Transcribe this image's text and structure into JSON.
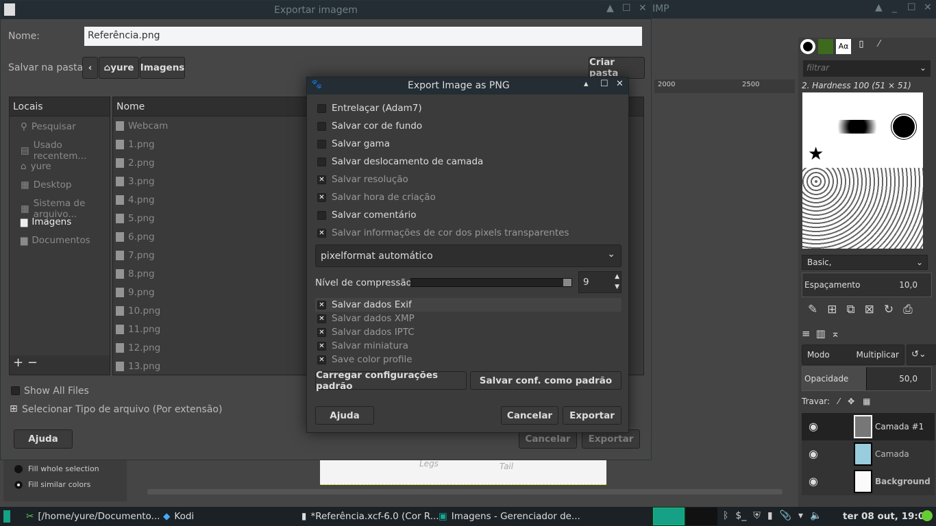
{
  "gimp": {
    "title": "IMP",
    "ruler": [
      "2000",
      "2500"
    ],
    "dock": {
      "filter_placeholder": "filtrar",
      "brush_name": "2. Hardness 100 (51 × 51)",
      "preset": "Basic,",
      "spacing_label": "Espaçamento",
      "spacing_value": "10,0",
      "mode_label": "Modo",
      "mode_value": "Multiplicar",
      "opacity_label": "Opacidade",
      "opacity_value": "50,0",
      "opacity_fraction": 0.5,
      "lock_label": "Travar:",
      "layers": [
        {
          "name": "Camada #1",
          "selected": true
        },
        {
          "name": "Camada",
          "selected": false
        },
        {
          "name": "Background",
          "selected": false
        }
      ]
    },
    "toolbox": {
      "fill_whole": "Fill whole selection",
      "fill_similar": "Fill similar colors"
    },
    "canvas_text": [
      "Legs",
      "Tail"
    ]
  },
  "export": {
    "title": "Exportar imagem",
    "name_label": "Nome:",
    "name_value": "Referência.png",
    "folder_label": "Salvar na pasta:",
    "path": [
      "yure",
      "Imagens"
    ],
    "create_folder": "Criar pasta",
    "places_header": "Locais",
    "places": [
      "Pesquisar",
      "Usado recentem...",
      "yure",
      "Desktop",
      "Sistema de arquivo...",
      "Imagens",
      "Documentos"
    ],
    "files_header": "Nome",
    "files": [
      "Webcam",
      "1.png",
      "2.png",
      "3.png",
      "4.png",
      "5.png",
      "6.png",
      "7.png",
      "8.png",
      "9.png",
      "10.png",
      "11.png",
      "12.png",
      "13.png"
    ],
    "show_all": "Show All Files",
    "select_type": "Selecionar Tipo de arquivo (Por extensão)",
    "help": "Ajuda",
    "cancel": "Cancelar",
    "export": "Exportar"
  },
  "png": {
    "title": "Export Image as PNG",
    "options": [
      {
        "label": "Entrelaçar (Adam7)",
        "checked": false
      },
      {
        "label": "Salvar cor de fundo",
        "checked": false
      },
      {
        "label": "Salvar gama",
        "checked": false
      },
      {
        "label": "Salvar deslocamento de camada",
        "checked": false
      },
      {
        "label": "Salvar resolução",
        "checked": true
      },
      {
        "label": "Salvar hora de criação",
        "checked": true
      },
      {
        "label": "Salvar comentário",
        "checked": false
      },
      {
        "label": "Salvar informações de cor dos pixels transparentes",
        "checked": true
      }
    ],
    "pixelformat": "pixelformat automático",
    "compression_label": "Nível de compressão:",
    "compression_value": "9",
    "meta": [
      {
        "label": "Salvar dados Exif",
        "checked": true
      },
      {
        "label": "Salvar dados XMP",
        "checked": true
      },
      {
        "label": "Salvar dados IPTC",
        "checked": true
      },
      {
        "label": "Salvar miniatura",
        "checked": true
      },
      {
        "label": "Save color profile",
        "checked": true
      }
    ],
    "load_defaults": "Carregar configurações padrão",
    "save_defaults": "Salvar conf. como padrão",
    "help": "Ajuda",
    "cancel": "Cancelar",
    "export": "Exportar"
  },
  "taskbar": {
    "items": [
      "[/home/yure/Documento...",
      "Kodi",
      "*Referência.xcf-6.0 (Cor R...",
      "Imagens - Gerenciador de..."
    ],
    "clock": "ter 08 out, 19:03"
  }
}
